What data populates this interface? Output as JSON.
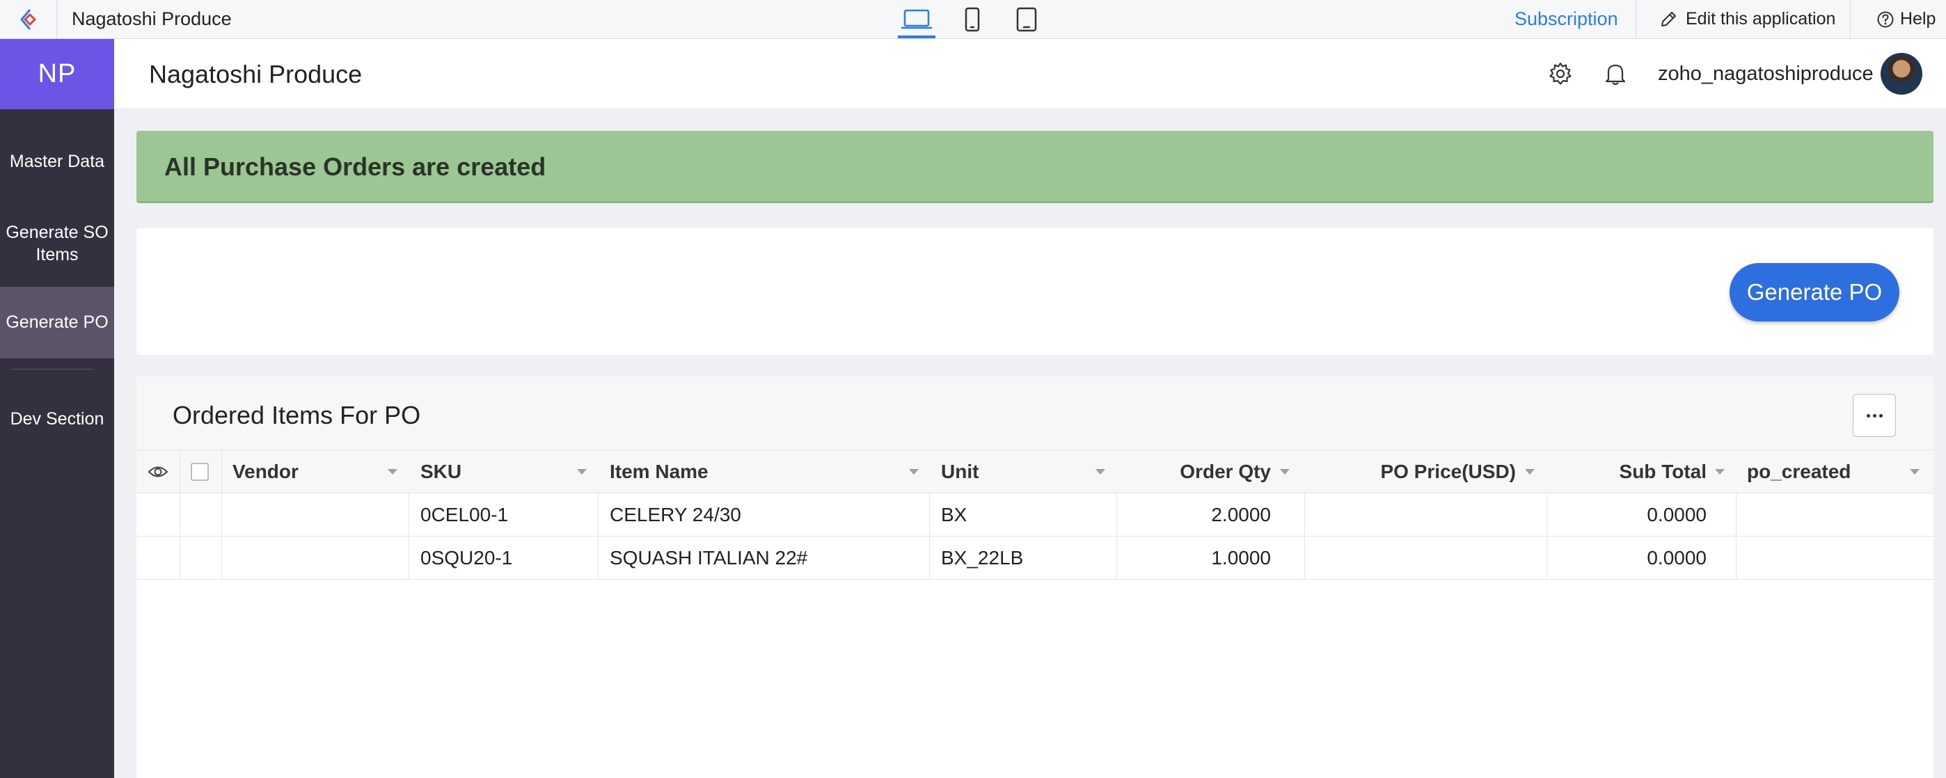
{
  "topbar": {
    "app_name": "Nagatoshi Produce",
    "devices": [
      "desktop-icon",
      "mobile-icon",
      "tablet-icon"
    ],
    "active_device": "desktop",
    "subscription": "Subscription",
    "edit_app": "Edit this application",
    "help": "Help"
  },
  "sidebar": {
    "logo": "NP",
    "items": [
      {
        "label": "Master Data"
      },
      {
        "label": "Generate SO Items"
      },
      {
        "label": "Generate PO"
      },
      {
        "label": "Dev Section"
      }
    ],
    "active_item": "Generate PO"
  },
  "header": {
    "title": "Nagatoshi Produce",
    "icons": [
      "gear-icon",
      "bell-icon"
    ],
    "username": "zoho_nagatoshiproduce"
  },
  "banner": {
    "message": "All Purchase Orders are created"
  },
  "panel": {
    "button_label": "Generate PO"
  },
  "report": {
    "title": "Ordered Items For PO",
    "columns": [
      "Vendor",
      "SKU",
      "Item Name",
      "Unit",
      "Order Qty",
      "PO Price(USD)",
      "Sub Total",
      "po_created"
    ],
    "rows": [
      {
        "vendor": "",
        "sku": "0CEL00-1",
        "item_name": "CELERY 24/30",
        "unit": "BX",
        "order_qty": "2.0000",
        "po_price": "",
        "sub_total": "0.0000",
        "po_created": ""
      },
      {
        "vendor": "",
        "sku": "0SQU20-1",
        "item_name": "SQUASH ITALIAN 22#",
        "unit": "BX_22LB",
        "order_qty": "1.0000",
        "po_price": "",
        "sub_total": "0.0000",
        "po_created": ""
      }
    ]
  },
  "colors": {
    "accent": "#2d7be5",
    "sidebar_bg": "#35303f",
    "sidebar_logo": "#6b55e6",
    "banner_success": "#9cc794",
    "button_primary": "#2e6fe0"
  }
}
